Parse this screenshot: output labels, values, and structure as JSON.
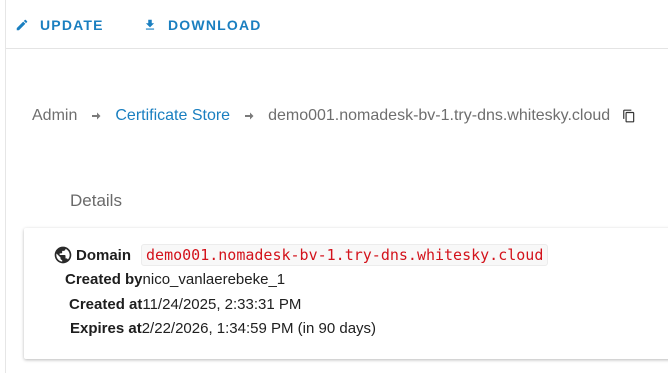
{
  "toolbar": {
    "update_label": "UPDATE",
    "download_label": "DOWNLOAD",
    "update_icon": "pencil-icon",
    "download_icon": "download-icon"
  },
  "breadcrumb": {
    "root": "Admin",
    "parent": "Certificate Store",
    "current": "demo001.nomadesk-bv-1.try-dns.whitesky.cloud",
    "separator_icon": "arrow-right-icon",
    "copy_icon": "copy-icon"
  },
  "details": {
    "title": "Details",
    "domain_icon": "globe-icon",
    "domain_label": "Domain",
    "domain_value": "demo001.nomadesk-bv-1.try-dns.whitesky.cloud",
    "created_by_label": "Created by",
    "created_by_value": "nico_vanlaerebeke_1",
    "created_at_label": "Created at",
    "created_at_value": "11/24/2025, 2:33:31 PM",
    "expires_at_label": "Expires at",
    "expires_at_value": "2/22/2026, 1:34:59 PM (in 90 days)"
  },
  "colors": {
    "accent": "#1a7fc0",
    "code_red": "#d3121b",
    "muted_text": "#6e6e6e"
  }
}
